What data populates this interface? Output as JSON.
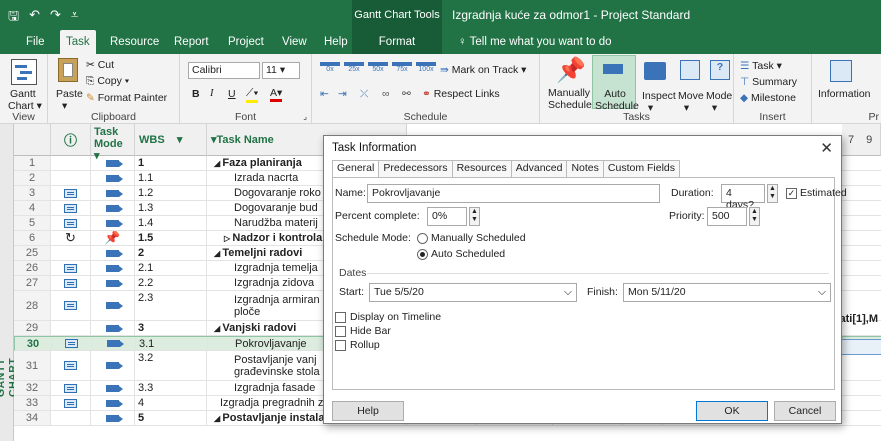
{
  "titlebar": {
    "context_tab": "Gantt Chart Tools",
    "document_title": "Izgradnja kuće za odmor1  -  Project Standard"
  },
  "tabs": [
    "File",
    "Task",
    "Resource",
    "Report",
    "Project",
    "View",
    "Help",
    "Format"
  ],
  "tell_me": "Tell me what you want to do",
  "ribbon": {
    "view_group": {
      "gantt": "Gantt",
      "chart": "Chart",
      "label": "View"
    },
    "clipboard": {
      "paste": "Paste",
      "cut": "Cut",
      "copy": "Copy",
      "format_painter": "Format Painter",
      "label": "Clipboard"
    },
    "font": {
      "name": "Calibri",
      "size": "11",
      "bold": "B",
      "italic": "I",
      "underline": "U",
      "label": "Font"
    },
    "schedule": {
      "mark_on_track": "Mark on Track",
      "respect_links": "Respect Links",
      "label": "Schedule",
      "pct": [
        "0x",
        "25x",
        "50x",
        "75x",
        "100x"
      ]
    },
    "tasks": {
      "manually": "Manually",
      "schedule1": "Schedule",
      "auto": "Auto",
      "schedule2": "Schedule",
      "inspect": "Inspect",
      "move": "Move",
      "mode": "Mode",
      "label": "Tasks"
    },
    "insert": {
      "task": "Task",
      "summary": "Summary",
      "milestone": "Milestone",
      "label": "Insert"
    },
    "properties": {
      "information": "Information",
      "label": "Pr"
    }
  },
  "sidebar_label": "GANTT CHART",
  "grid": {
    "headers": {
      "info": "ⓘ",
      "task_mode": "Task Mode",
      "wbs": "WBS",
      "task_name": "Task Name"
    },
    "timescale": [
      "7",
      "9"
    ],
    "rows": [
      {
        "id": "1",
        "wbs": "1",
        "name": "Faza planiranja",
        "summary": true,
        "ind": ""
      },
      {
        "id": "2",
        "wbs": "1.1",
        "name": "Izrada nacrta",
        "summary": false,
        "ind": ""
      },
      {
        "id": "3",
        "wbs": "1.2",
        "name": "Dogovaranje roko",
        "summary": false,
        "ind": "table"
      },
      {
        "id": "4",
        "wbs": "1.3",
        "name": "Dogovaranje bud",
        "summary": false,
        "ind": "table"
      },
      {
        "id": "5",
        "wbs": "1.4",
        "name": "Narudžba materij",
        "summary": false,
        "ind": "table"
      },
      {
        "id": "6",
        "wbs": "1.5",
        "name": "Nadzor i kontrola",
        "summary": true,
        "ind": "recur"
      },
      {
        "id": "25",
        "wbs": "2",
        "name": "Temeljni radovi",
        "summary": true,
        "ind": ""
      },
      {
        "id": "26",
        "wbs": "2.1",
        "name": "Izgradnja temelja",
        "summary": false,
        "ind": "table"
      },
      {
        "id": "27",
        "wbs": "2.2",
        "name": "Izgradnja zidova",
        "summary": false,
        "ind": "table"
      },
      {
        "id": "28",
        "wbs": "2.3",
        "name": "Izgradnja armiran",
        "name2": "ploče",
        "summary": false,
        "ind": "table"
      },
      {
        "id": "29",
        "wbs": "3",
        "name": "Vanjski radovi",
        "summary": true,
        "ind": ""
      },
      {
        "id": "30",
        "wbs": "3.1",
        "name": "Pokrovljavanje",
        "summary": false,
        "ind": "table"
      },
      {
        "id": "31",
        "wbs": "3.2",
        "name": "Postavljanje vanj",
        "name2": "građevinske stola",
        "summary": false,
        "ind": "table"
      },
      {
        "id": "32",
        "wbs": "3.3",
        "name": "Izgradnja fasade",
        "summary": false,
        "ind": "table"
      },
      {
        "id": "33",
        "wbs": "4",
        "name": "Izgradja pregradnih zidova",
        "summary": false,
        "ind": "table"
      },
      {
        "id": "34",
        "wbs": "5",
        "name": "Postavljanje instalacija",
        "summary": true,
        "ind": ""
      }
    ],
    "row33_cols": {
      "duration": "15.87 days?",
      "start": "Mon 6/29/20",
      "finish": "Wed 7/22/20",
      "pred": "32",
      "res": "Majstori[5],Zidar[3,3]"
    },
    "row34_cols": {
      "duration": "63.47 days?",
      "start": "Wed 7/22/20",
      "finish": "Mon 10/19/:",
      "pred": "33"
    },
    "row28_res": "lati[1],M"
  },
  "dialog": {
    "title": "Task Information",
    "close": "✕",
    "tabs": [
      "General",
      "Predecessors",
      "Resources",
      "Advanced",
      "Notes",
      "Custom Fields"
    ],
    "name_label": "Name:",
    "name_value": "Pokrovljavanje",
    "duration_label": "Duration:",
    "duration_value": "4 days?",
    "estimated_label": "Estimated",
    "estimated_checked": true,
    "percent_label": "Percent complete:",
    "percent_value": "0%",
    "priority_label": "Priority:",
    "priority_value": "500",
    "schedule_mode_label": "Schedule Mode:",
    "manually_scheduled": "Manually Scheduled",
    "auto_scheduled": "Auto Scheduled",
    "dates_label": "Dates",
    "start_label": "Start:",
    "start_value": "Tue 5/5/20",
    "finish_label": "Finish:",
    "finish_value": "Mon 5/11/20",
    "display_on_timeline": "Display on Timeline",
    "hide_bar": "Hide Bar",
    "rollup": "Rollup",
    "help": "Help",
    "ok": "OK",
    "cancel": "Cancel"
  }
}
